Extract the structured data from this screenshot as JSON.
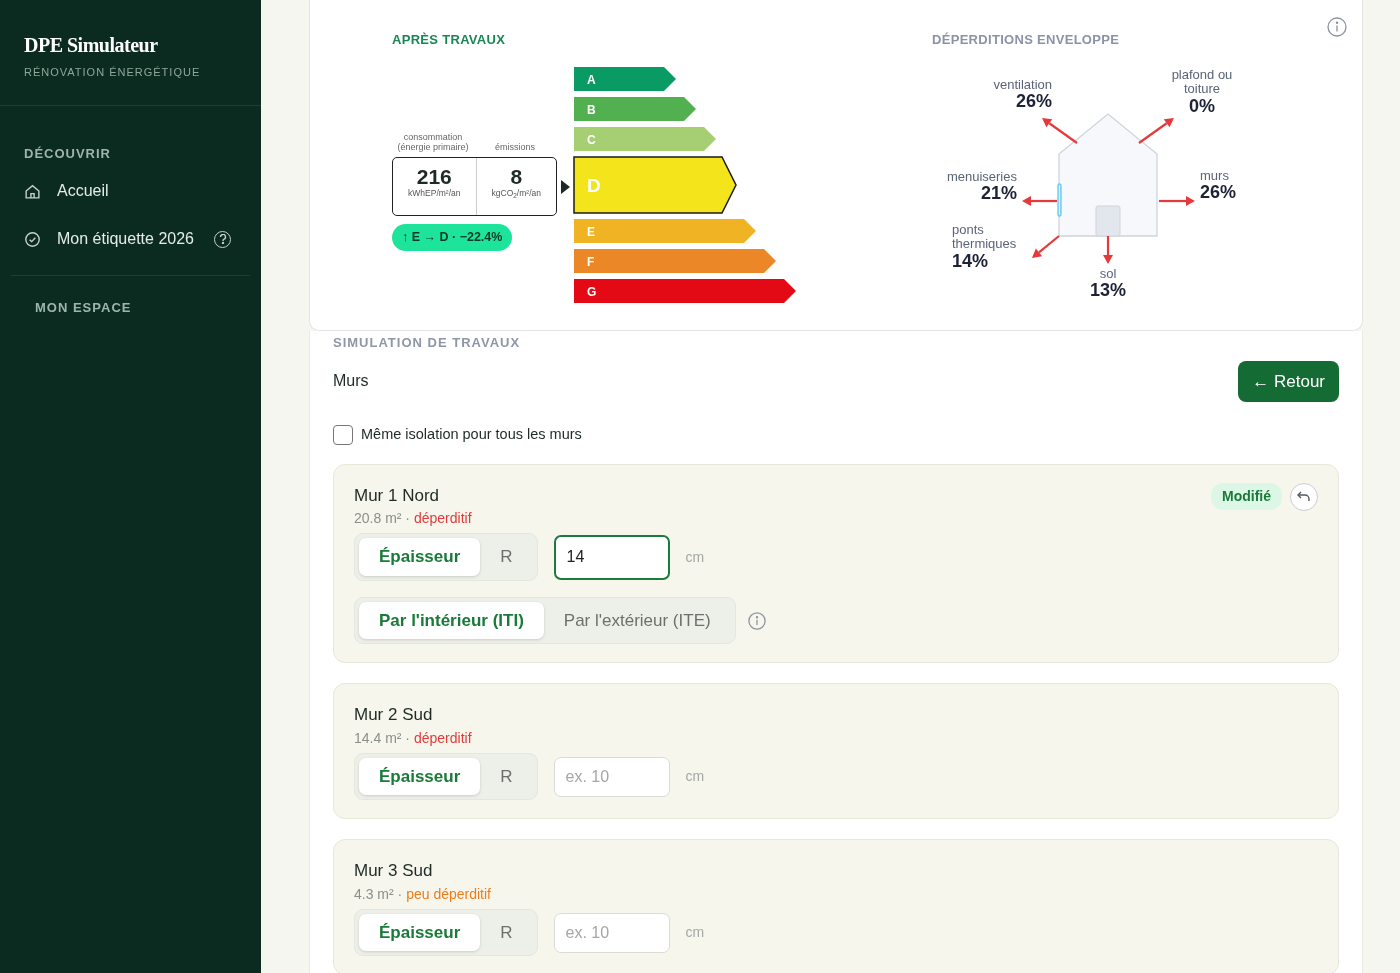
{
  "sidebar": {
    "brand": "DPE Simulateur",
    "tagline": "RÉNOVATION ÉNERGÉTIQUE",
    "sections": [
      {
        "title": "DÉCOUVRIR",
        "items": [
          {
            "label": "Accueil",
            "selected": false,
            "help": false
          },
          {
            "label": "Mon étiquette 2026",
            "selected": false,
            "help": true
          }
        ]
      },
      {
        "title": "MON ESPACE"
      }
    ]
  },
  "rating": {
    "title": "APRÈS TRAVAUX",
    "consumption": {
      "label": "consommation (énergie primaire)",
      "value": "216",
      "unit": "kWhEP/m²/an"
    },
    "emissions": {
      "label": "émissions",
      "value": "8",
      "unit": "kgCO$_{2}$/m²/an"
    },
    "change": "↑ E → D · −22.4%",
    "classes": [
      {
        "letter": "A",
        "color": "#0a9a63",
        "selected": false
      },
      {
        "letter": "B",
        "color": "#52b050",
        "selected": false
      },
      {
        "letter": "C",
        "color": "#a5cf72",
        "selected": false
      },
      {
        "letter": "D",
        "color": "#f4e41c",
        "selected": true
      },
      {
        "letter": "E",
        "color": "#f0b323",
        "selected": false
      },
      {
        "letter": "F",
        "color": "#ec8727",
        "selected": false
      },
      {
        "letter": "G",
        "color": "#e30a16",
        "selected": false
      }
    ]
  },
  "losses": {
    "title": "DÉPERDITIONS ENVELOPPE",
    "items": [
      {
        "label": "ventilation",
        "value": "26%"
      },
      {
        "label": "plafond ou toiture",
        "value": "0%"
      },
      {
        "label": "menuiseries",
        "value": "21%"
      },
      {
        "label": "murs",
        "value": "26%"
      },
      {
        "label": "ponts thermiques",
        "value": "14%"
      },
      {
        "label": "sol",
        "value": "13%"
      }
    ]
  },
  "simulation": {
    "heading": "SIMULATION DE TRAVAUX",
    "title": "Murs",
    "back_button": "← Retour",
    "same_insulation": {
      "label": "Même isolation pour tous les murs",
      "checked": false
    },
    "walls": [
      {
        "name": "Mur 1 Nord",
        "area": "20.8 m²",
        "separator": "·",
        "loss": {
          "text": "déperditif",
          "color": "#e03c3c"
        },
        "modes": [
          {
            "label": "Épaisseur",
            "selected": true
          },
          {
            "label": "R",
            "selected": false
          }
        ],
        "thickness": {
          "value": "14",
          "focused": true
        },
        "unit": "cm",
        "placements": [
          {
            "label": "Par l'intérieur (ITI)",
            "selected": true
          },
          {
            "label": "Par l'extérieur (ITE)",
            "selected": false
          }
        ],
        "modified": true,
        "badge": "Modifié"
      },
      {
        "name": "Mur 2 Sud",
        "area": "14.4 m²",
        "separator": "·",
        "loss": {
          "text": "déperditif",
          "color": "#e03c3c"
        },
        "modes": [
          {
            "label": "Épaisseur",
            "selected": true
          },
          {
            "label": "R",
            "selected": false
          }
        ],
        "thickness": {
          "placeholder": "ex. 10",
          "focused": false
        },
        "unit": "cm",
        "modified": false
      },
      {
        "name": "Mur 3 Sud",
        "area": "4.3 m²",
        "separator": "·",
        "loss": {
          "text": "peu déperditif",
          "color": "#ef7d1a"
        },
        "modes": [
          {
            "label": "Épaisseur",
            "selected": true
          },
          {
            "label": "R",
            "selected": false
          }
        ],
        "thickness": {
          "placeholder": "ex. 10",
          "focused": false
        },
        "unit": "cm",
        "modified": false
      }
    ]
  }
}
